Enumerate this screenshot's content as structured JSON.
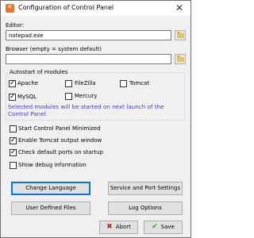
{
  "window": {
    "title": "Configuration of Control Panel",
    "close_glyph": "✕"
  },
  "editor": {
    "label": "Editor:",
    "value": "notepad.exe"
  },
  "browser": {
    "label": "Browser (empty = system default)",
    "value": ""
  },
  "autostart": {
    "title": "Autostart of modules",
    "modules": [
      {
        "label": "Apache",
        "checked": true
      },
      {
        "label": "FileZilla",
        "checked": false
      },
      {
        "label": "Tomcat",
        "checked": false
      },
      {
        "label": "MySQL",
        "checked": true
      },
      {
        "label": "Mercury",
        "checked": false
      }
    ],
    "info": "Selected modules will be started on next launch of the Control Panel.",
    "info_color": "#3d3dd6"
  },
  "options": [
    {
      "label": "Start Control Panel Minimized",
      "checked": false
    },
    {
      "label": "Enable Tomcat output window",
      "checked": true
    },
    {
      "label": "Check default ports on startup",
      "checked": true
    },
    {
      "label": "Show debug information",
      "checked": false
    }
  ],
  "buttons": {
    "change_language": "Change Language",
    "service_port": "Service and Port Settings",
    "user_files": "User Defined Files",
    "log_options": "Log Options",
    "abort": "Abort",
    "save": "Save"
  },
  "icons": {
    "app": "xampp-icon",
    "folder": "folder-icon",
    "abort": "x-icon",
    "save": "checkmark-icon"
  },
  "colors": {
    "accent": "#0078d7",
    "abort": "#d11a1a",
    "save": "#1f9d2b"
  }
}
